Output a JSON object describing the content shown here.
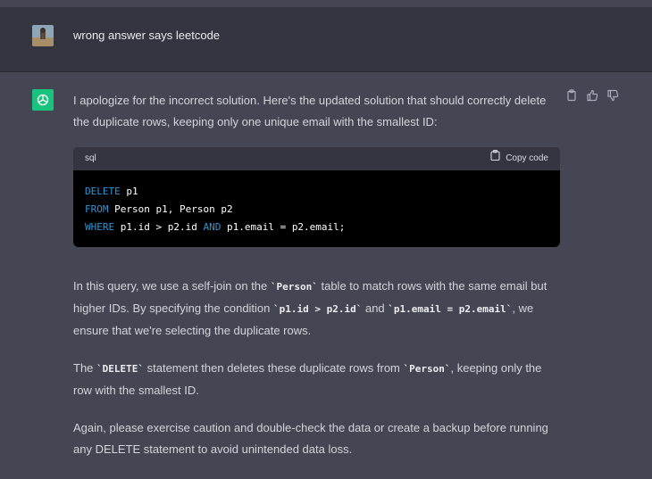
{
  "user_message": {
    "text": "wrong answer says leetcode"
  },
  "assistant": {
    "intro": "I apologize for the incorrect solution. Here's the updated solution that should correctly delete the duplicate rows, keeping only one unique email with the smallest ID:",
    "code": {
      "language": "sql",
      "copy_label": "Copy code",
      "line1": {
        "kw": "DELETE",
        "rest": " p1"
      },
      "line2": {
        "kw": "FROM",
        "rest": " Person p1, Person p2"
      },
      "line3": {
        "kw1": "WHERE",
        "mid": " p1.id > p2.id ",
        "kw2": "AND",
        "rest": " p1.email = p2.email;"
      }
    },
    "para1": {
      "a": "In this query, we use a self-join on the ",
      "code1": "`Person`",
      "b": " table to match rows with the same email but higher IDs. By specifying the condition ",
      "code2": "`p1.id > p2.id`",
      "c": " and ",
      "code3": "`p1.email = p2.email`",
      "d": ", we ensure that we're selecting the duplicate rows."
    },
    "para2": {
      "a": "The ",
      "code1": "`DELETE`",
      "b": " statement then deletes these duplicate rows from ",
      "code2": "`Person`",
      "c": ", keeping only the row with the smallest ID."
    },
    "para3": "Again, please exercise caution and double-check the data or create a backup before running any DELETE statement to avoid unintended data loss."
  },
  "colors": {
    "brand": "#19c37d",
    "keyword": "#2e95d3",
    "user_bg": "#343541",
    "assistant_bg": "#444654"
  },
  "icons": [
    "user-avatar",
    "openai-logo-icon",
    "copy-icon",
    "thumbs-up-icon",
    "thumbs-down-icon",
    "clipboard-icon"
  ]
}
